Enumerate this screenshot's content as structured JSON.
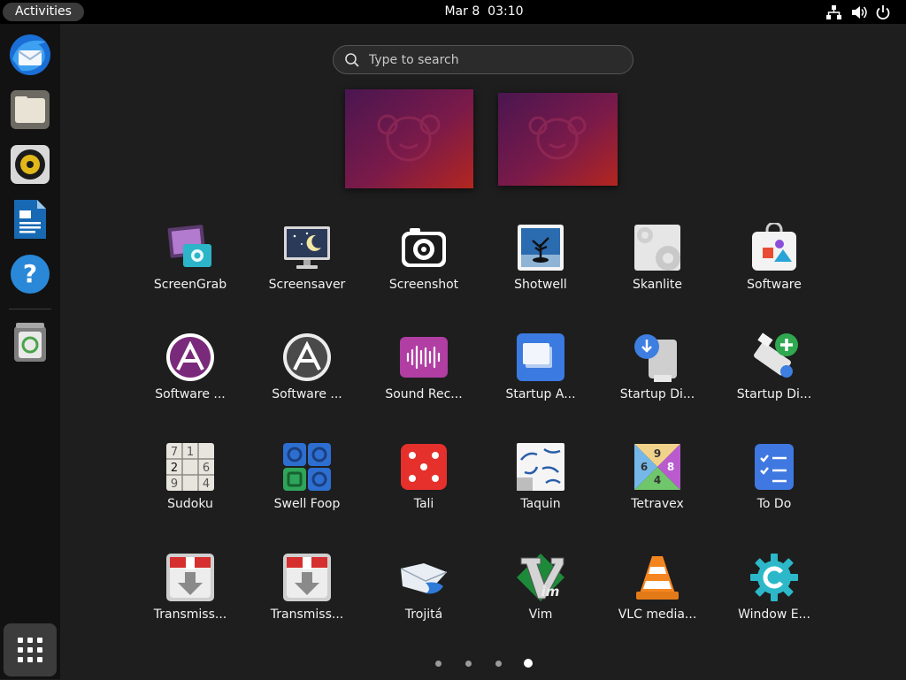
{
  "topbar": {
    "activities_label": "Activities",
    "date": "Mar 8",
    "time": "03:10"
  },
  "search": {
    "placeholder": "Type to search"
  },
  "dock": [
    "thunderbird-icon",
    "files-icon",
    "rhythmbox-icon",
    "libreoffice-writer-icon",
    "help-icon",
    "trash-icon"
  ],
  "apps": [
    {
      "label": "ScreenGrab"
    },
    {
      "label": "Screensaver"
    },
    {
      "label": "Screenshot"
    },
    {
      "label": "Shotwell"
    },
    {
      "label": "Skanlite"
    },
    {
      "label": "Software"
    },
    {
      "label": "Software ..."
    },
    {
      "label": "Software ..."
    },
    {
      "label": "Sound Rec..."
    },
    {
      "label": "Startup A..."
    },
    {
      "label": "Startup Di..."
    },
    {
      "label": "Startup Di..."
    },
    {
      "label": "Sudoku"
    },
    {
      "label": "Swell Foop"
    },
    {
      "label": "Tali"
    },
    {
      "label": "Taquin"
    },
    {
      "label": "Tetravex"
    },
    {
      "label": "To Do"
    },
    {
      "label": "Transmiss..."
    },
    {
      "label": "Transmiss..."
    },
    {
      "label": "Trojitá"
    },
    {
      "label": "Vim"
    },
    {
      "label": "VLC media..."
    },
    {
      "label": "Window E..."
    }
  ],
  "sudoku_digits": [
    "7",
    "1",
    "2",
    "6",
    "9",
    "4"
  ],
  "tetravex_digits": [
    "9",
    "6",
    "8",
    "4"
  ],
  "vim_text": "im",
  "pages": {
    "count": 4,
    "current": 4
  }
}
